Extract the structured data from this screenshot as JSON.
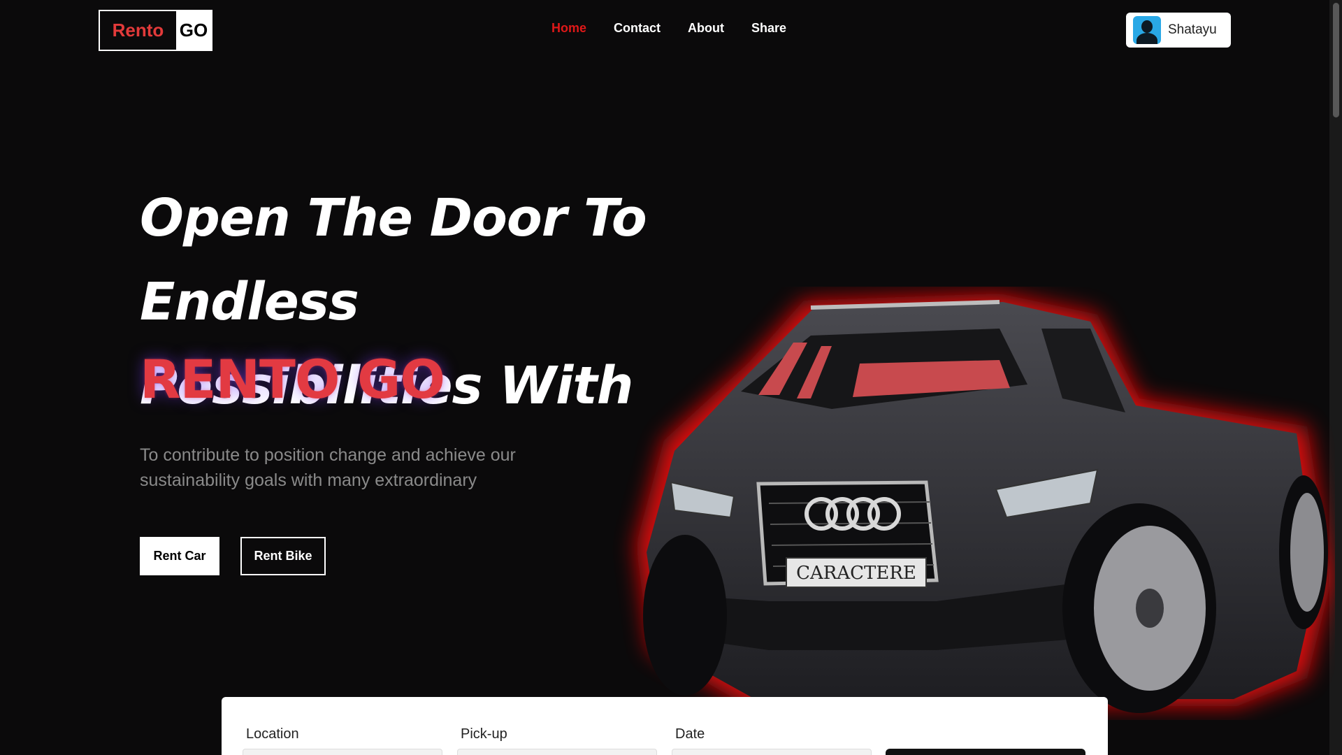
{
  "logo": {
    "part1": "Rento",
    "part2": "GO"
  },
  "nav": {
    "home": "Home",
    "contact": "Contact",
    "about": "About",
    "share": "Share"
  },
  "user": {
    "name": "Shatayu",
    "icon": "user-avatar-icon"
  },
  "hero": {
    "line1": "Open The Door To Endless",
    "line2": "Possibilities With",
    "brand": "RENTO GO",
    "subtitle": "To contribute to position change and achieve our sustainability goals with many extraordinary",
    "rent_car": "Rent Car",
    "rent_bike": "Rent Bike"
  },
  "booking": {
    "location_label": "Location",
    "pickup_label": "Pick-up",
    "date_label": "Date"
  },
  "colors": {
    "accent": "#e23a3a",
    "nav_active": "#e01818",
    "background": "#0b0a0b"
  }
}
